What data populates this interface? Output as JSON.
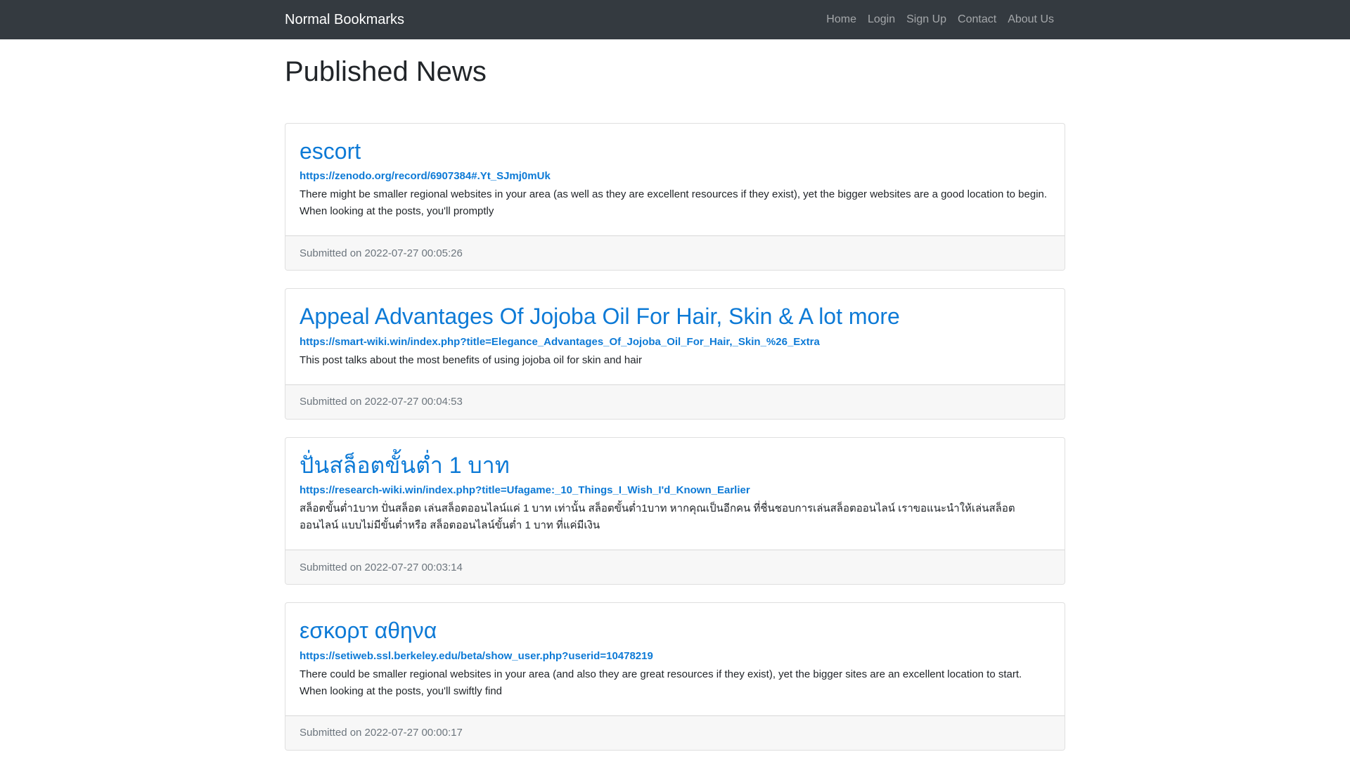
{
  "navbar": {
    "brand": "Normal Bookmarks",
    "links": [
      "Home",
      "Login",
      "Sign Up",
      "Contact",
      "About Us"
    ]
  },
  "main": {
    "title": "Published News",
    "posts": [
      {
        "title": "escort",
        "url": "https://zenodo.org/record/6907384#.Yt_SJmj0mUk",
        "description": "There might be smaller regional websites in your area (as well as they are excellent resources if they exist), yet the bigger websites are a good location to begin. When looking at the posts, you'll promptly",
        "submitted": "Submitted on 2022-07-27 00:05:26"
      },
      {
        "title": "Appeal Advantages Of Jojoba Oil For Hair, Skin & A lot more",
        "url": "https://smart-wiki.win/index.php?title=Elegance_Advantages_Of_Jojoba_Oil_For_Hair,_Skin_%26_Extra",
        "description": "This post talks about the most benefits of using jojoba oil for skin and hair",
        "submitted": "Submitted on 2022-07-27 00:04:53"
      },
      {
        "title": "ปั่นสล็อตขั้นต่ำ 1 บาท",
        "url": "https://research-wiki.win/index.php?title=Ufagame:_10_Things_I_Wish_I'd_Known_Earlier",
        "description": "สล็อตขั้นต่ำ1บาท ปั่นสล็อต เล่นสล็อตออนไลน์แค่ 1 บาท เท่านั้น สล็อตขั้นต่ำ1บาท หากคุณเป็นอีกคน ที่ชื่นชอบการเล่นสล็อตออนไลน์ เราขอแนะนำให้เล่นสล็อตออนไลน์ แบบไม่มีขั้นต่ำหรือ สล็อตออนไลน์ขั้นต่ำ 1 บาท ที่แค่มีเงิน",
        "submitted": "Submitted on 2022-07-27 00:03:14"
      },
      {
        "title": "εσκορτ αθηνα",
        "url": "https://setiweb.ssl.berkeley.edu/beta/show_user.php?userid=10478219",
        "description": "There could be smaller regional websites in your area (and also they are great resources if they exist), yet the bigger sites are an excellent location to start. When looking at the posts, you'll swiftly find",
        "submitted": "Submitted on 2022-07-27 00:00:17"
      }
    ]
  },
  "colors": {
    "navbar_bg": "#343a40",
    "link": "#0d7ad6",
    "footer_bg": "#f7f7f7"
  }
}
